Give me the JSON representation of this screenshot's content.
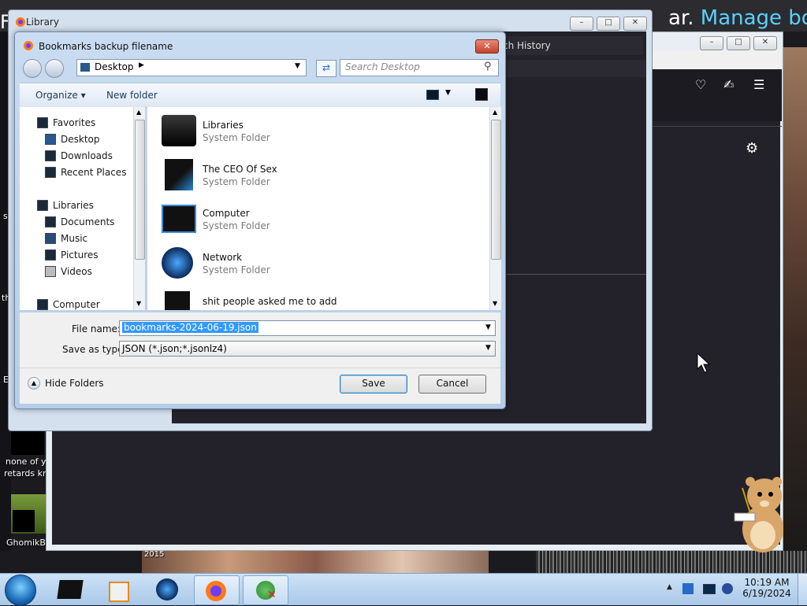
{
  "desktop": {
    "icon_labels": [
      "none of y",
      "retards kn",
      "GhomikB",
      "2015"
    ],
    "left_fragments": [
      "s",
      "th",
      "E"
    ]
  },
  "background_window": {
    "heading_prefix": "F",
    "heading_mid": "ar.",
    "heading_link": "Manage book",
    "search_history": "ch History"
  },
  "library_window": {
    "title": "Library"
  },
  "dialog": {
    "title": "Bookmarks backup filename",
    "address": "Desktop",
    "search_placeholder": "Search Desktop",
    "toolbar": {
      "organize": "Organize",
      "new_folder": "New folder"
    },
    "nav": {
      "favorites": "Favorites",
      "favorites_items": [
        "Desktop",
        "Downloads",
        "Recent Places"
      ],
      "libraries": "Libraries",
      "libraries_items": [
        "Documents",
        "Music",
        "Pictures",
        "Videos"
      ],
      "computer": "Computer"
    },
    "files": [
      {
        "name": "Libraries",
        "type": "System Folder"
      },
      {
        "name": "The CEO Of Sex",
        "type": "System Folder"
      },
      {
        "name": "Computer",
        "type": "System Folder"
      },
      {
        "name": "Network",
        "type": "System Folder"
      },
      {
        "name": "shit people asked me to add",
        "type": ""
      }
    ],
    "file_name_label": "File name:",
    "file_name_value": "bookmarks-2024-06-19.json",
    "save_type_label": "Save as type:",
    "save_type_value": "JSON (*.json;*.jsonlz4)",
    "hide_folders": "Hide Folders",
    "save": "Save",
    "cancel": "Cancel"
  },
  "taskbar": {
    "time": "10:19 AM",
    "date": "6/19/2024"
  }
}
